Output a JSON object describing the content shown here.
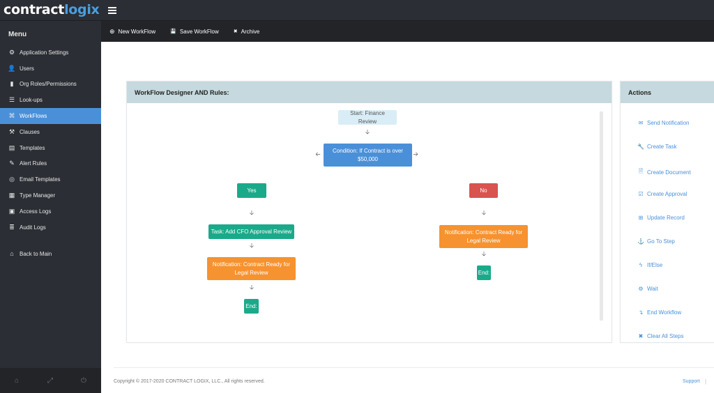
{
  "header": {
    "logo_part1": "contract",
    "logo_part2": "logix"
  },
  "sidebar": {
    "title": "Menu",
    "items": [
      {
        "label": "Application Settings",
        "icon": "cogs-icon",
        "glyph": "⚙",
        "active": false
      },
      {
        "label": "Users",
        "icon": "user-icon",
        "glyph": "👤",
        "active": false
      },
      {
        "label": "Org Roles/Permissions",
        "icon": "book-icon",
        "glyph": "▮",
        "active": false
      },
      {
        "label": "Look-ups",
        "icon": "list-icon",
        "glyph": "☰",
        "active": false
      },
      {
        "label": "WorkFlows",
        "icon": "sitemap-icon",
        "glyph": "⌘",
        "active": true
      },
      {
        "label": "Clauses",
        "icon": "gavel-icon",
        "glyph": "⚒",
        "active": false
      },
      {
        "label": "Templates",
        "icon": "file-icon",
        "glyph": "▤",
        "active": false
      },
      {
        "label": "Alert Rules",
        "icon": "edit-icon",
        "glyph": "✎",
        "active": false
      },
      {
        "label": "Email Templates",
        "icon": "compass-icon",
        "glyph": "◎",
        "active": false
      },
      {
        "label": "Type Manager",
        "icon": "grid-icon",
        "glyph": "▦",
        "active": false
      },
      {
        "label": "Access Logs",
        "icon": "archive-icon",
        "glyph": "▣",
        "active": false
      },
      {
        "label": "Audit Logs",
        "icon": "list-alt-icon",
        "glyph": "≣",
        "active": false
      }
    ],
    "back_to_main": {
      "label": "Back to Main",
      "icon": "home-icon",
      "glyph": "⌂"
    },
    "footer_icons": [
      {
        "name": "home-icon",
        "glyph": "⌂"
      },
      {
        "name": "fullscreen-icon",
        "glyph": "⤢"
      },
      {
        "name": "power-icon",
        "glyph": "⏻"
      }
    ]
  },
  "toolbar": {
    "new_label": "New WorkFlow",
    "new_glyph": "⊕",
    "save_label": "Save WorkFlow",
    "save_glyph": "💾",
    "archive_label": "Archive",
    "archive_glyph": "✖"
  },
  "designer": {
    "title": "WorkFlow Designer AND Rules:",
    "start": "Start: Finance Review",
    "condition": "Condition: If Contract is over $50,000",
    "yes_branch": {
      "label": "Yes",
      "task": "Task: Add CFO Approval Review",
      "notification": "Notification: Contract Ready for Legal Review",
      "end": "End:"
    },
    "no_branch": {
      "label": "No",
      "notification": "Notification: Contract Ready for Legal Review",
      "end": "End:"
    },
    "arrow_down": "🡣",
    "arrow_left": "🡠",
    "arrow_right": "🡢"
  },
  "actions": {
    "title": "Actions",
    "items": [
      {
        "label": "Send Notification",
        "icon": "envelope-icon",
        "glyph": "✉"
      },
      {
        "label": "Create Task",
        "icon": "wrench-icon",
        "glyph": "🔧"
      },
      {
        "label": "Create Document",
        "icon": "document-icon",
        "glyph": "🗎"
      },
      {
        "label": "Create Approval",
        "icon": "check-square-icon",
        "glyph": "☑"
      },
      {
        "label": "Update Record",
        "icon": "plus-square-icon",
        "glyph": "⊞"
      },
      {
        "label": "Go To Step",
        "icon": "anchor-icon",
        "glyph": "⚓"
      },
      {
        "label": "If/Else",
        "icon": "bolt-icon",
        "glyph": "ϟ"
      },
      {
        "label": "Wait",
        "icon": "cogs-icon",
        "glyph": "⚙"
      },
      {
        "label": "End Workflow",
        "icon": "level-down-icon",
        "glyph": "↴"
      },
      {
        "label": "Clear All Steps",
        "icon": "close-icon",
        "glyph": "✖"
      }
    ]
  },
  "footer": {
    "copyright": "Copyright © 2017-2020 CONTRACT LOGIX, LLC., All rights reserved.",
    "support": "Support",
    "separator": "|"
  }
}
